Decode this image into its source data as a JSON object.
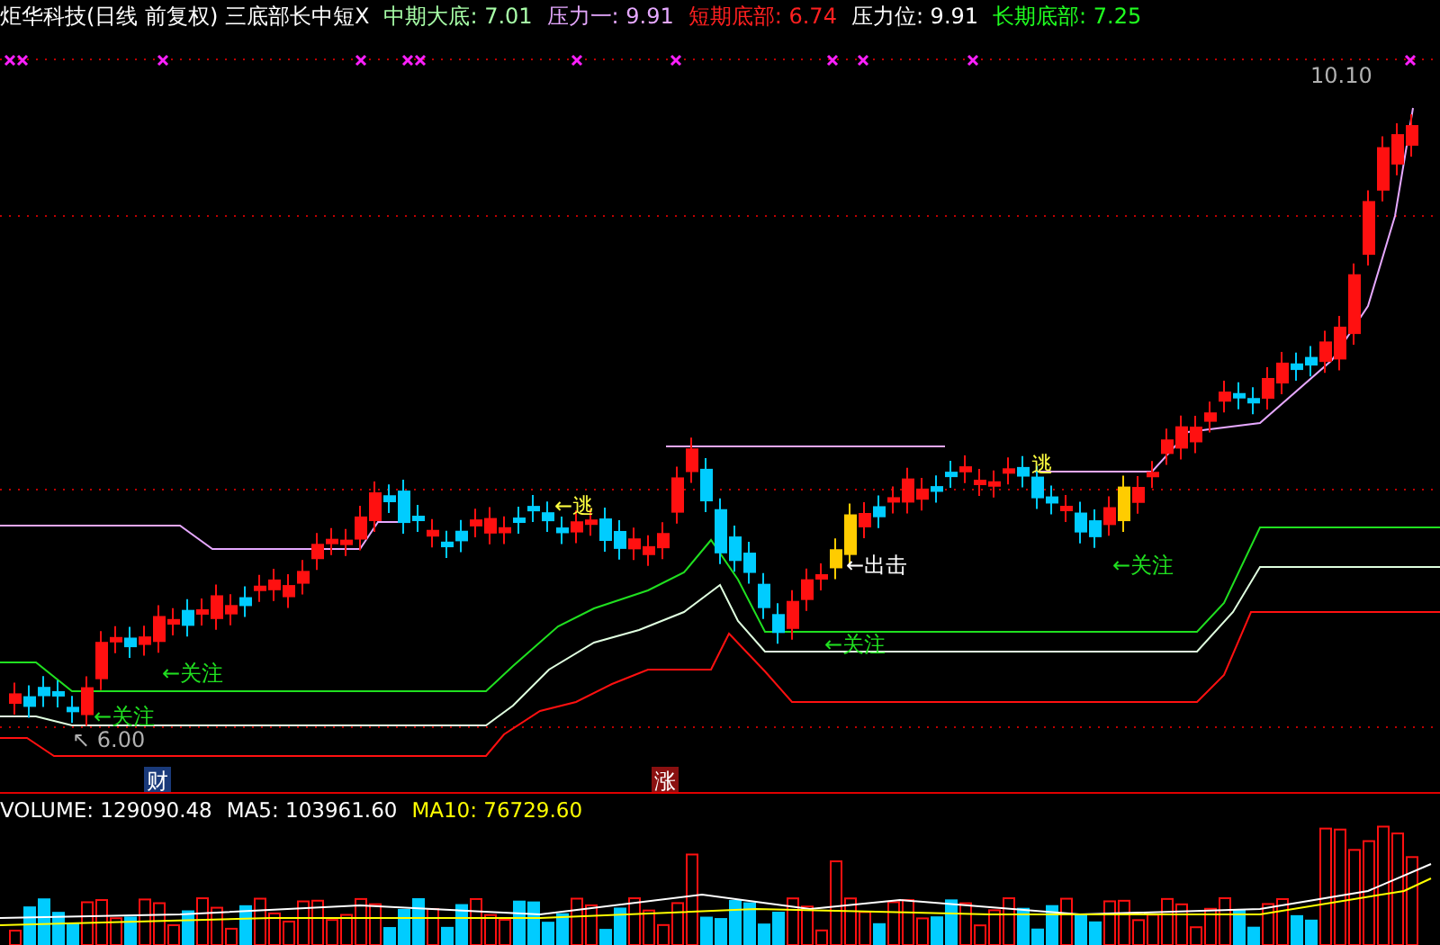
{
  "header": {
    "title": "炬华科技(日线 前复权) 三底部长中短X",
    "indicators": [
      {
        "text": "中期大底: 7.01",
        "color": "#a8ffa8"
      },
      {
        "text": "压力一: 9.91",
        "color": "#e6a8ff"
      },
      {
        "text": "短期底部: 6.74",
        "color": "#ff2020"
      },
      {
        "text": "压力位: 9.91",
        "color": "#ffffff"
      },
      {
        "text": "长期底部: 7.25",
        "color": "#20ff20"
      }
    ]
  },
  "annotations": [
    {
      "text": "←关注",
      "color": "#20e020"
    },
    {
      "text": "←关注",
      "color": "#20e020"
    },
    {
      "text": "↖ 6.00",
      "color": "#b0b0b0"
    },
    {
      "text": "←逃",
      "color": "#ffff40"
    },
    {
      "text": "逃",
      "color": "#ffff40"
    },
    {
      "text": "←出击",
      "color": "#ffffff"
    },
    {
      "text": "←关注",
      "color": "#20e020"
    },
    {
      "text": "←关注",
      "color": "#20e020"
    },
    {
      "text": "10.10",
      "color": "#b0b0b0"
    }
  ],
  "events": [
    {
      "text": "财",
      "color": "#1a3a7a"
    },
    {
      "text": "涨",
      "color": "#8a1010"
    }
  ],
  "volume": {
    "items": [
      {
        "text": "VOLUME: 129090.48",
        "color": "#ffffff"
      },
      {
        "text": "MA5: 103961.60",
        "color": "#ffffff"
      },
      {
        "text": "MA10: 76729.60",
        "color": "#ffff00"
      }
    ]
  }
}
